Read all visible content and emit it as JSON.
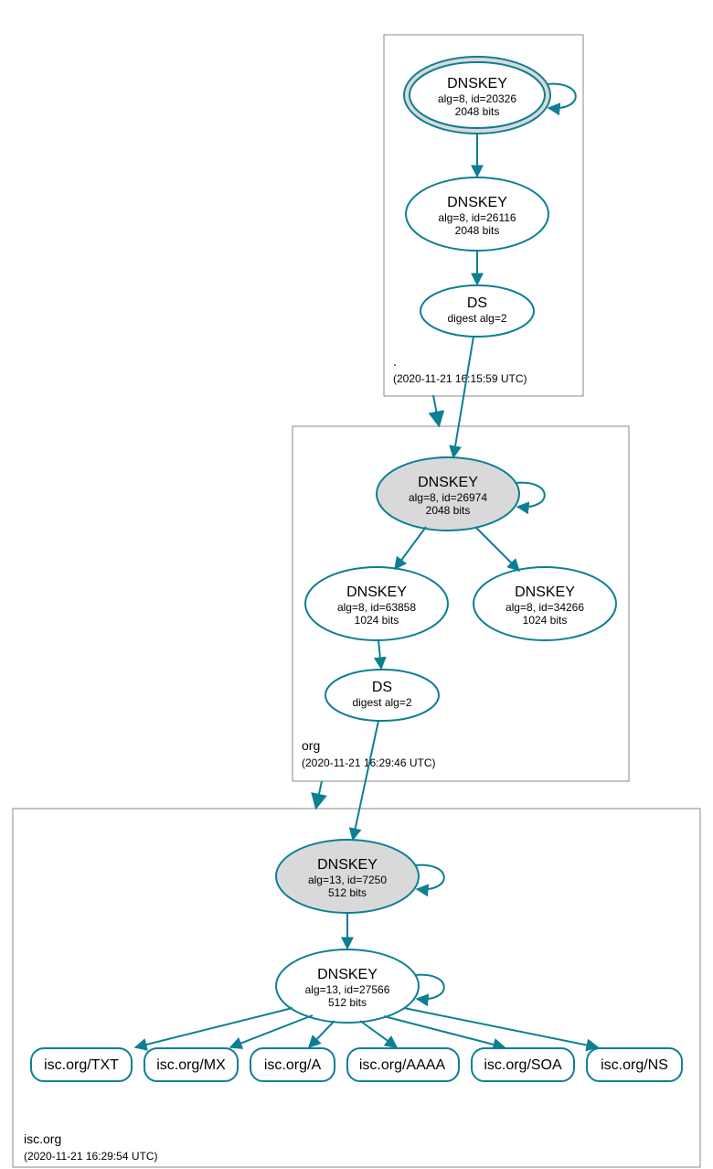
{
  "colors": {
    "accent": "#0d7f93",
    "fill": "#d9d9d9",
    "box": "#888888"
  },
  "zones": {
    "root": {
      "name": ".",
      "timestamp": "(2020-11-21 16:15:59 UTC)"
    },
    "org": {
      "name": "org",
      "timestamp": "(2020-11-21 16:29:46 UTC)"
    },
    "isc": {
      "name": "isc.org",
      "timestamp": "(2020-11-21 16:29:54 UTC)"
    }
  },
  "nodes": {
    "root_ksk": {
      "title": "DNSKEY",
      "line1": "alg=8, id=20326",
      "line2": "2048 bits"
    },
    "root_zsk": {
      "title": "DNSKEY",
      "line1": "alg=8, id=26116",
      "line2": "2048 bits"
    },
    "root_ds": {
      "title": "DS",
      "line1": "digest alg=2"
    },
    "org_ksk": {
      "title": "DNSKEY",
      "line1": "alg=8, id=26974",
      "line2": "2048 bits"
    },
    "org_zsk1": {
      "title": "DNSKEY",
      "line1": "alg=8, id=63858",
      "line2": "1024 bits"
    },
    "org_zsk2": {
      "title": "DNSKEY",
      "line1": "alg=8, id=34266",
      "line2": "1024 bits"
    },
    "org_ds": {
      "title": "DS",
      "line1": "digest alg=2"
    },
    "isc_ksk": {
      "title": "DNSKEY",
      "line1": "alg=13, id=7250",
      "line2": "512 bits"
    },
    "isc_zsk": {
      "title": "DNSKEY",
      "line1": "alg=13, id=27566",
      "line2": "512 bits"
    }
  },
  "rrsets": {
    "txt": "isc.org/TXT",
    "mx": "isc.org/MX",
    "a": "isc.org/A",
    "aaaa": "isc.org/AAAA",
    "soa": "isc.org/SOA",
    "ns": "isc.org/NS"
  }
}
